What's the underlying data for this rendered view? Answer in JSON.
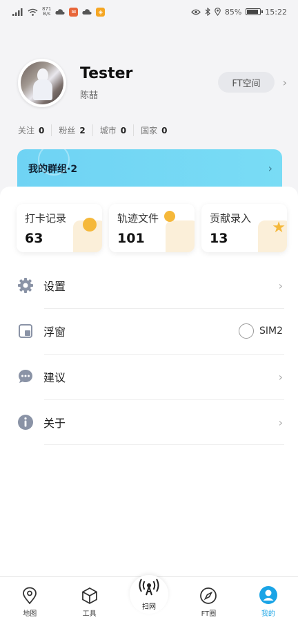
{
  "status_bar": {
    "signal_text": "4G",
    "net_speed_top": "871",
    "net_speed_unit": "B/s",
    "battery_percent": "85%",
    "time": "15:22",
    "battery_level": 0.85
  },
  "profile": {
    "username": "Tester",
    "subname": "陈喆",
    "ft_space_label": "FT空间"
  },
  "stats": [
    {
      "label": "关注",
      "value": "0"
    },
    {
      "label": "粉丝",
      "value": "2"
    },
    {
      "label": "城市",
      "value": "0"
    },
    {
      "label": "国家",
      "value": "0"
    }
  ],
  "group_banner": {
    "label": "我的群组·2"
  },
  "cards": [
    {
      "label": "打卡记录",
      "value": "63"
    },
    {
      "label": "轨迹文件",
      "value": "101"
    },
    {
      "label": "贡献录入",
      "value": "13"
    }
  ],
  "menu": [
    {
      "label": "设置",
      "icon": "gear-icon"
    },
    {
      "label": "浮窗",
      "icon": "float-window-icon",
      "toggle_label": "SIM2"
    },
    {
      "label": "建议",
      "icon": "chat-icon"
    },
    {
      "label": "关于",
      "icon": "info-icon"
    }
  ],
  "bottom_nav": [
    {
      "label": "地图",
      "icon": "map-pin-icon",
      "active": false
    },
    {
      "label": "工具",
      "icon": "cube-icon",
      "active": false
    },
    {
      "label": "扫网",
      "icon": "antenna-icon",
      "active": false
    },
    {
      "label": "FT圈",
      "icon": "compass-icon",
      "active": false
    },
    {
      "label": "我的",
      "icon": "profile-icon",
      "active": true
    }
  ],
  "colors": {
    "accent": "#1aa4e6",
    "banner": "#6fd3f4",
    "card_dot": "#f5b83a",
    "icon_gray": "#8a93a6"
  }
}
